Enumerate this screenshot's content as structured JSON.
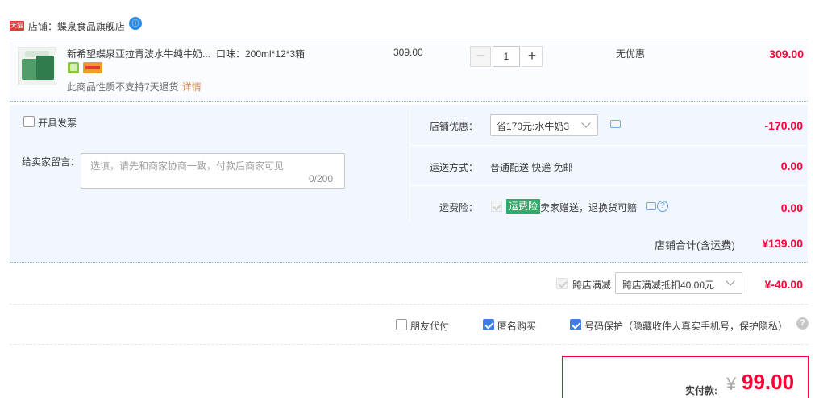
{
  "shop": {
    "badge": "天猫",
    "label_prefix": "店铺：",
    "name": "蝶泉食品旗舰店",
    "chat_icon": "wangwang-chat-icon"
  },
  "item": {
    "title": "新希望蝶泉亚拉青波水牛纯牛奶...",
    "sku": "口味：200ml*12*3箱",
    "note": "此商品性质不支持7天退货",
    "detail_link": "详情",
    "unit_price": "309.00",
    "quantity": "1",
    "minus_label": "−",
    "plus_label": "+",
    "discount": "无优惠",
    "total": "309.00"
  },
  "invoice": {
    "label": "开具发票",
    "checked": false
  },
  "message": {
    "label": "给卖家留言：",
    "placeholder": "选填，请先和商家协商一致，付款后商家可见",
    "count": "0/200"
  },
  "shop_discount": {
    "label": "店铺优惠：",
    "selected": "省170元:水牛奶3",
    "amount": "-170.00"
  },
  "shipping": {
    "label": "运送方式：",
    "text": "普通配送 快递 免邮",
    "amount": "0.00"
  },
  "insurance": {
    "label": "运费险：",
    "badge": "运费险",
    "text": "卖家赠送，退换货可赔",
    "amount": "0.00"
  },
  "subtotal": {
    "label": "店铺合计(含运费)",
    "amount": "¥139.00"
  },
  "cross_store": {
    "label": "跨店满减",
    "selected": "跨店满减抵扣40.00元",
    "amount": "¥-40.00"
  },
  "options": {
    "friend_pay": "朋友代付",
    "anonymous": "匿名购买",
    "phone_protect": "号码保护（隐藏收件人真实手机号，保护隐私）",
    "help": "?"
  },
  "payment": {
    "label": "实付款:",
    "currency": "¥",
    "amount": "99.00"
  },
  "colors": {
    "price_red": "#ff0036",
    "panel_blue": "#f2f7ff",
    "checkbox_blue": "#3e7ee6",
    "insurance_green": "#36a86a"
  }
}
